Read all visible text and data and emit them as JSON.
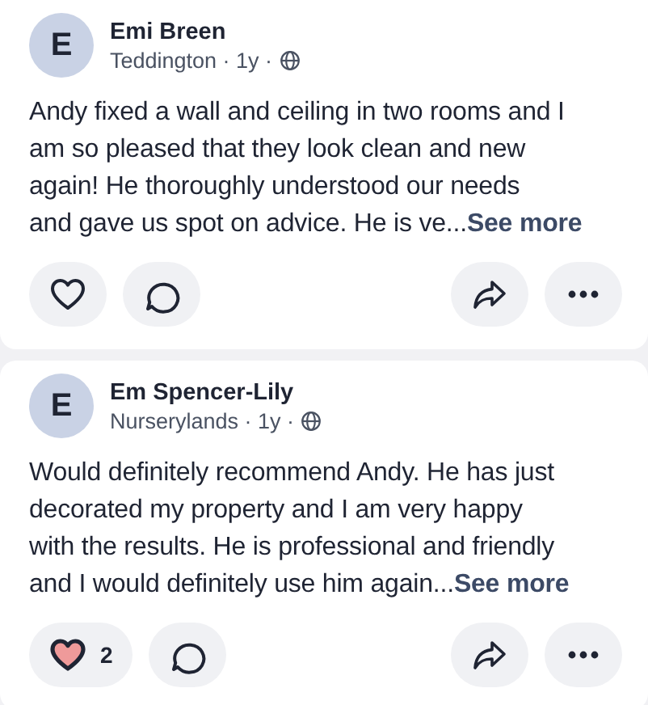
{
  "reviews": [
    {
      "avatar": "E",
      "name": "Emi Breen",
      "meta": "Teddington · 1y ·",
      "body_lines": [
        "Andy fixed a wall and ceiling in two rooms and I",
        "am so pleased that they look clean and new",
        "again! He thoroughly understood our needs",
        "and gave us spot on advice. He is ve..."
      ],
      "see_more": "See more",
      "liked": false
    },
    {
      "avatar": "E",
      "name": "Em Spencer-Lily",
      "meta": "Nurserylands · 1y ·",
      "body_lines": [
        "Would definitely recommend Andy. He has just",
        "decorated my property and I am very happy",
        "with the results. He is professional and friendly",
        "and I would definitely use him again..."
      ],
      "see_more": "See more",
      "liked": true,
      "like_count": "2"
    }
  ]
}
